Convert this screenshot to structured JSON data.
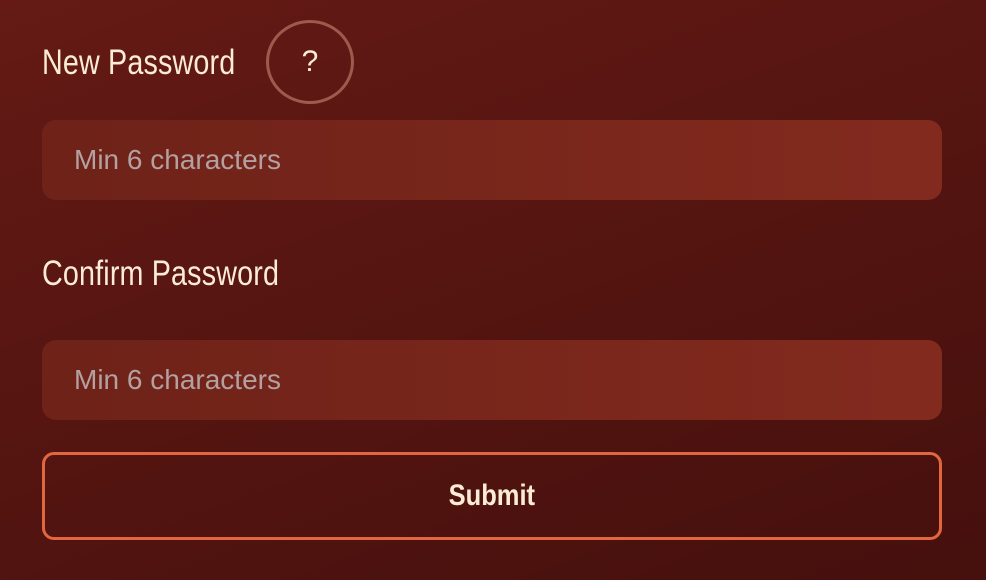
{
  "new_password": {
    "label": "New Password",
    "help_label": "?",
    "placeholder": "Min 6 characters"
  },
  "confirm_password": {
    "label": "Confirm Password",
    "placeholder": "Min 6 characters"
  },
  "submit": {
    "label": "Submit"
  },
  "colors": {
    "background": "#561511",
    "input_background": "#7a261b",
    "label_text": "#fcecd6",
    "placeholder_text": "#b4a0a0",
    "button_border": "#e2663e",
    "help_border": "#a0594d"
  }
}
